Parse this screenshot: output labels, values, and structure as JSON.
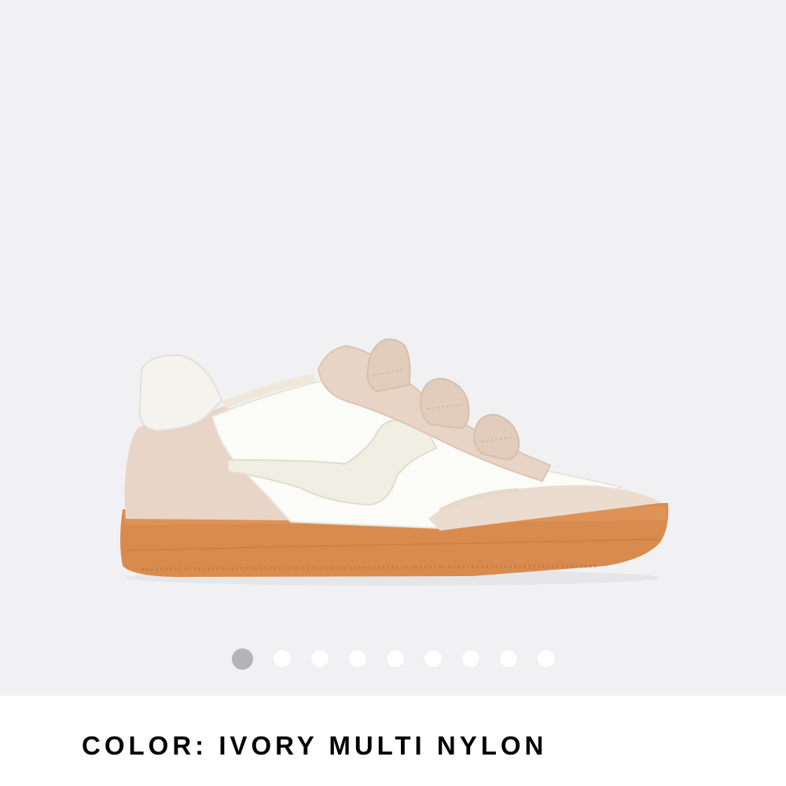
{
  "gallery": {
    "background_color": "#f1f1f3",
    "image_semantic": "sneaker-product-photo",
    "slide_count": 9,
    "active_slide": 1
  },
  "color_selector": {
    "label": "COLOR:",
    "value": "IVORY MULTI NYLON"
  },
  "colors": {
    "dot_active": "#b4b4b6",
    "dot_inactive": "#ffffff",
    "sole": "#d9894a",
    "suede": "#e7d6c9",
    "leather": "#fafaf7"
  }
}
